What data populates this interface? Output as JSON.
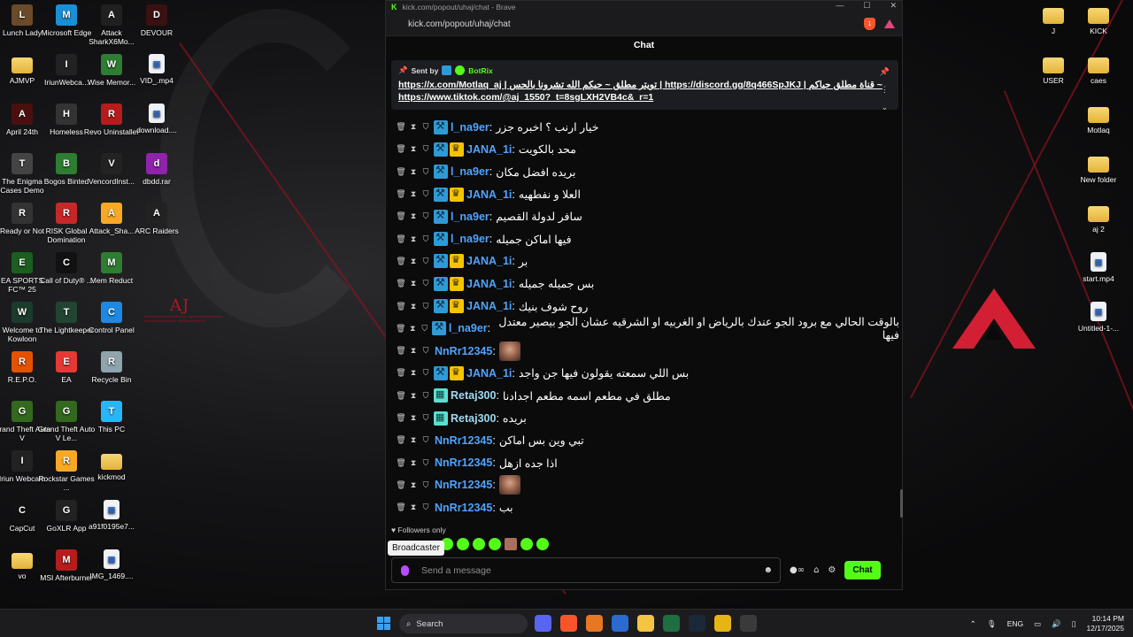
{
  "browser": {
    "title": "kick.com/popout/uhaj/chat - Brave",
    "url": "kick.com/popout/uhaj/chat",
    "brave_shield_count": "1"
  },
  "chat": {
    "header": "Chat",
    "pinned": {
      "sent_by_label": "Sent by",
      "sender": "BotRix",
      "message": "https://x.com/Motlaq_aj | تويتر مطلق ~ حيكم الله تشرونا بالحس | https://discord.gg/8q466SpJKJ | قناة مطلق حياكم ~ https://www.tiktok.com/@aj_1550?_t=8sgLXH2VB4c&_r=1"
    },
    "messages": [
      {
        "user": "l_na9er",
        "color": "#4fa3ff",
        "badges": [
          "mod"
        ],
        "text": "خيار ارنب ؟ اخبره جزر"
      },
      {
        "user": "JANA_1i",
        "color": "#4fa3ff",
        "badges": [
          "mod",
          "crown"
        ],
        "text": "محد بالكويت"
      },
      {
        "user": "l_na9er",
        "color": "#4fa3ff",
        "badges": [
          "mod"
        ],
        "text": "بريده افضل مكان"
      },
      {
        "user": "JANA_1i",
        "color": "#4fa3ff",
        "badges": [
          "mod",
          "crown"
        ],
        "text": "العلا و نفطهيه"
      },
      {
        "user": "l_na9er",
        "color": "#4fa3ff",
        "badges": [
          "mod"
        ],
        "text": "سافر لدولة القصيم"
      },
      {
        "user": "l_na9er",
        "color": "#4fa3ff",
        "badges": [
          "mod"
        ],
        "text": "فيها اماكن جميله"
      },
      {
        "user": "JANA_1i",
        "color": "#4fa3ff",
        "badges": [
          "mod",
          "crown"
        ],
        "text": "بر"
      },
      {
        "user": "JANA_1i",
        "color": "#4fa3ff",
        "badges": [
          "mod",
          "crown"
        ],
        "text": "بس جميله جميله"
      },
      {
        "user": "JANA_1i",
        "color": "#4fa3ff",
        "badges": [
          "mod",
          "crown"
        ],
        "text": "روح شوف بنيك"
      },
      {
        "user": "l_na9er",
        "color": "#4fa3ff",
        "badges": [
          "mod"
        ],
        "text": "بالوقت الحالي مع برود الجو عندك بالرياض او الغربيه او الشرقيه عشان الجو بيصير معتدل فيها"
      },
      {
        "user": "NnRr12345",
        "color": "#4fa3ff",
        "badges": [],
        "text": "",
        "emote": true
      },
      {
        "user": "JANA_1i",
        "color": "#4fa3ff",
        "badges": [
          "mod",
          "crown"
        ],
        "text": "بس اللي سمعته يقولون فيها جن واجد"
      },
      {
        "user": "Retaj300",
        "color": "#9fd9f0",
        "badges": [
          "gift"
        ],
        "text": "مطلق في مطعم اسمه مطعم اجدادنا"
      },
      {
        "user": "Retaj300",
        "color": "#9fd9f0",
        "badges": [
          "gift"
        ],
        "text": "بريده"
      },
      {
        "user": "NnRr12345",
        "color": "#4fa3ff",
        "badges": [],
        "text": "تبي وين بس اماكن"
      },
      {
        "user": "NnRr12345",
        "color": "#4fa3ff",
        "badges": [],
        "text": "اذا جده ازهل"
      },
      {
        "user": "NnRr12345",
        "color": "#4fa3ff",
        "badges": [],
        "text": "",
        "emote": true
      },
      {
        "user": "NnRr12345",
        "color": "#4fa3ff",
        "badges": [],
        "text": "بب"
      }
    ],
    "followers_only": "Followers only",
    "tooltip": "Broadcaster",
    "input_placeholder": "Send a message",
    "send_label": "Chat"
  },
  "desktop_left": [
    {
      "label": "Lunch Lady",
      "icon": "game-icon",
      "color": "#6b4a2a"
    },
    {
      "label": "Microsoft Edge",
      "icon": "edge-icon",
      "color": "#1b8fd6"
    },
    {
      "label": "Attack SharkX6Mo...",
      "icon": "mouse-icon",
      "color": "#202020"
    },
    {
      "label": "DEVOUR",
      "icon": "game-icon",
      "color": "#3a1010"
    },
    {
      "label": "AJMVP",
      "icon": "folder-icon",
      "color": "folder"
    },
    {
      "label": "IriunWebca...",
      "icon": "camera-icon",
      "color": "#222"
    },
    {
      "label": "Wise Memor...",
      "icon": "app-icon",
      "color": "#2e7d32"
    },
    {
      "label": "VID_.mp4",
      "icon": "video-file-icon",
      "color": "file"
    },
    {
      "label": "April 24th",
      "icon": "game-icon",
      "color": "#4a1010"
    },
    {
      "label": "Homeless",
      "icon": "game-icon",
      "color": "#333"
    },
    {
      "label": "Revo Uninstaller",
      "icon": "app-icon",
      "color": "#b71c1c"
    },
    {
      "label": "download....",
      "icon": "file-icon",
      "color": "file"
    },
    {
      "label": "The Enigma Cases Demo",
      "icon": "game-icon",
      "color": "#444"
    },
    {
      "label": "Bogos Binted",
      "icon": "game-icon",
      "color": "#2e7d32"
    },
    {
      "label": "VencordInst...",
      "icon": "app-icon",
      "color": "#222"
    },
    {
      "label": "dbdd.rar",
      "icon": "archive-icon",
      "color": "#8e24aa"
    },
    {
      "label": "Ready or Not",
      "icon": "game-icon",
      "color": "#333"
    },
    {
      "label": "RISK Global Domination",
      "icon": "game-icon",
      "color": "#c62828"
    },
    {
      "label": "Attack_Sha...",
      "icon": "mouse-icon",
      "color": "#f9a825"
    },
    {
      "label": "ARC Raiders",
      "icon": "game-icon",
      "color": "#222"
    },
    {
      "label": "EA SPORTS FC™ 25",
      "icon": "game-icon",
      "color": "#1b5e20"
    },
    {
      "label": "Call of Duty® ...",
      "icon": "game-icon",
      "color": "#111"
    },
    {
      "label": "Mem Reduct",
      "icon": "app-icon",
      "color": "#2e7d32"
    },
    {
      "label": "",
      "icon": "",
      "color": ""
    },
    {
      "label": "Welcome to Kowloon",
      "icon": "game-icon",
      "color": "#1b3b2b"
    },
    {
      "label": "The Lightkeeper",
      "icon": "game-icon",
      "color": "#224433"
    },
    {
      "label": "Control Panel",
      "icon": "control-panel-icon",
      "color": "#1e88e5"
    },
    {
      "label": "",
      "icon": "",
      "color": ""
    },
    {
      "label": "R.E.P.O.",
      "icon": "game-icon",
      "color": "#e65100"
    },
    {
      "label": "EA",
      "icon": "ea-icon",
      "color": "#e53935"
    },
    {
      "label": "Recycle Bin",
      "icon": "recycle-bin-icon",
      "color": "#90a4ae"
    },
    {
      "label": "",
      "icon": "",
      "color": ""
    },
    {
      "label": "Grand Theft Auto V",
      "icon": "game-icon",
      "color": "#33691e"
    },
    {
      "label": "Grand Theft Auto V Le...",
      "icon": "game-icon",
      "color": "#33691e"
    },
    {
      "label": "This PC",
      "icon": "pc-icon",
      "color": "#29b6f6"
    },
    {
      "label": "",
      "icon": "",
      "color": ""
    },
    {
      "label": "Iriun Webcam",
      "icon": "camera-icon",
      "color": "#222"
    },
    {
      "label": "Rockstar Games ...",
      "icon": "rockstar-icon",
      "color": "#f9a825"
    },
    {
      "label": "kickmod",
      "icon": "folder-icon",
      "color": "folder"
    },
    {
      "label": "",
      "icon": "",
      "color": ""
    },
    {
      "label": "CapCut",
      "icon": "capcut-icon",
      "color": "#111"
    },
    {
      "label": "GoXLR App",
      "icon": "app-icon",
      "color": "#222"
    },
    {
      "label": "a91f0195e7...",
      "icon": "image-file-icon",
      "color": "file"
    },
    {
      "label": "",
      "icon": "",
      "color": ""
    },
    {
      "label": "vo",
      "icon": "folder-icon",
      "color": "folder"
    },
    {
      "label": "MSI Afterburner",
      "icon": "app-icon",
      "color": "#b71c1c"
    },
    {
      "label": "IMG_1469....",
      "icon": "image-file-icon",
      "color": "file"
    }
  ],
  "desktop_right": [
    {
      "label": "J",
      "icon": "folder-icon"
    },
    {
      "label": "KICK",
      "icon": "folder-icon"
    },
    {
      "label": "USER",
      "icon": "folder-icon"
    },
    {
      "label": "caes",
      "icon": "folder-icon"
    },
    {
      "label": "Motlaq",
      "icon": "folder-icon"
    },
    {
      "label": "New folder",
      "icon": "folder-icon"
    },
    {
      "label": "aj 2",
      "icon": "folder-icon"
    },
    {
      "label": "start.mp4",
      "icon": "video-file-icon"
    },
    {
      "label": "Untitled-1-...",
      "icon": "image-file-icon"
    }
  ],
  "wallpaper": {
    "monogram": "AJ"
  },
  "taskbar": {
    "search_label": "Search",
    "language": "ENG",
    "time": "10:14 PM",
    "date": "12/17/2025"
  }
}
